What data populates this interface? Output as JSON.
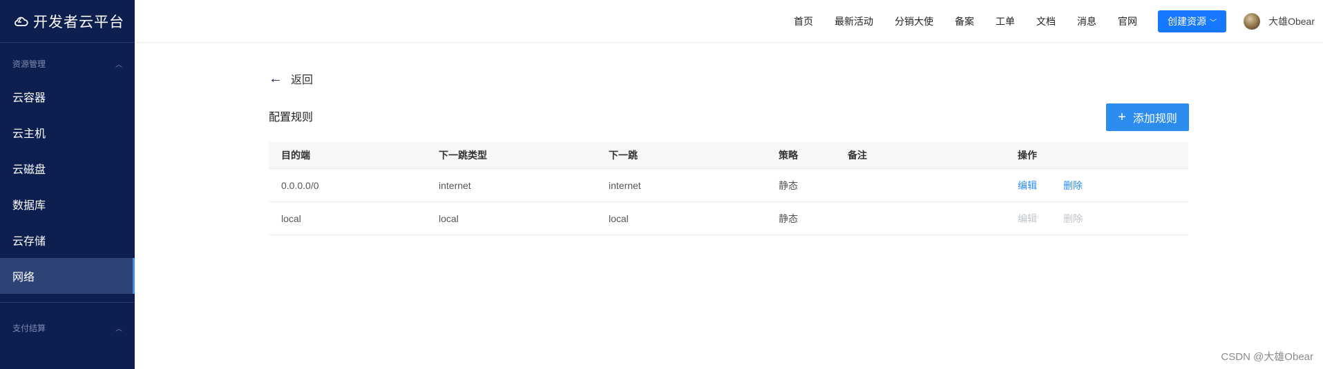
{
  "app": {
    "title": "开发者云平台"
  },
  "sidebar": {
    "group1_title": "资源管理",
    "items": [
      {
        "label": "云容器"
      },
      {
        "label": "云主机"
      },
      {
        "label": "云磁盘"
      },
      {
        "label": "数据库"
      },
      {
        "label": "云存储"
      },
      {
        "label": "网络",
        "active": true
      }
    ],
    "group2_title": "支付结算"
  },
  "topnav": {
    "links": [
      "首页",
      "最新活动",
      "分销大使",
      "备案",
      "工单",
      "文档",
      "消息",
      "官网"
    ],
    "create_label": "创建资源",
    "username": "大雄Obear"
  },
  "main": {
    "back_label": "返回",
    "section_title": "配置规则",
    "add_button_label": "添加规则",
    "table": {
      "columns": [
        "目的端",
        "下一跳类型",
        "下一跳",
        "策略",
        "备注",
        "操作"
      ],
      "rows": [
        {
          "dest": "0.0.0.0/0",
          "next_hop_type": "internet",
          "next_hop": "internet",
          "policy": "静态",
          "remark": "",
          "edit": "编辑",
          "delete": "删除",
          "actions_enabled": true
        },
        {
          "dest": "local",
          "next_hop_type": "local",
          "next_hop": "local",
          "policy": "静态",
          "remark": "",
          "edit": "编辑",
          "delete": "删除",
          "actions_enabled": false
        }
      ]
    }
  },
  "watermark": "CSDN @大雄Obear",
  "colors": {
    "sidebar_bg": "#0d1f4f",
    "accent": "#2d8cf0",
    "primary_button": "#1677ff"
  }
}
